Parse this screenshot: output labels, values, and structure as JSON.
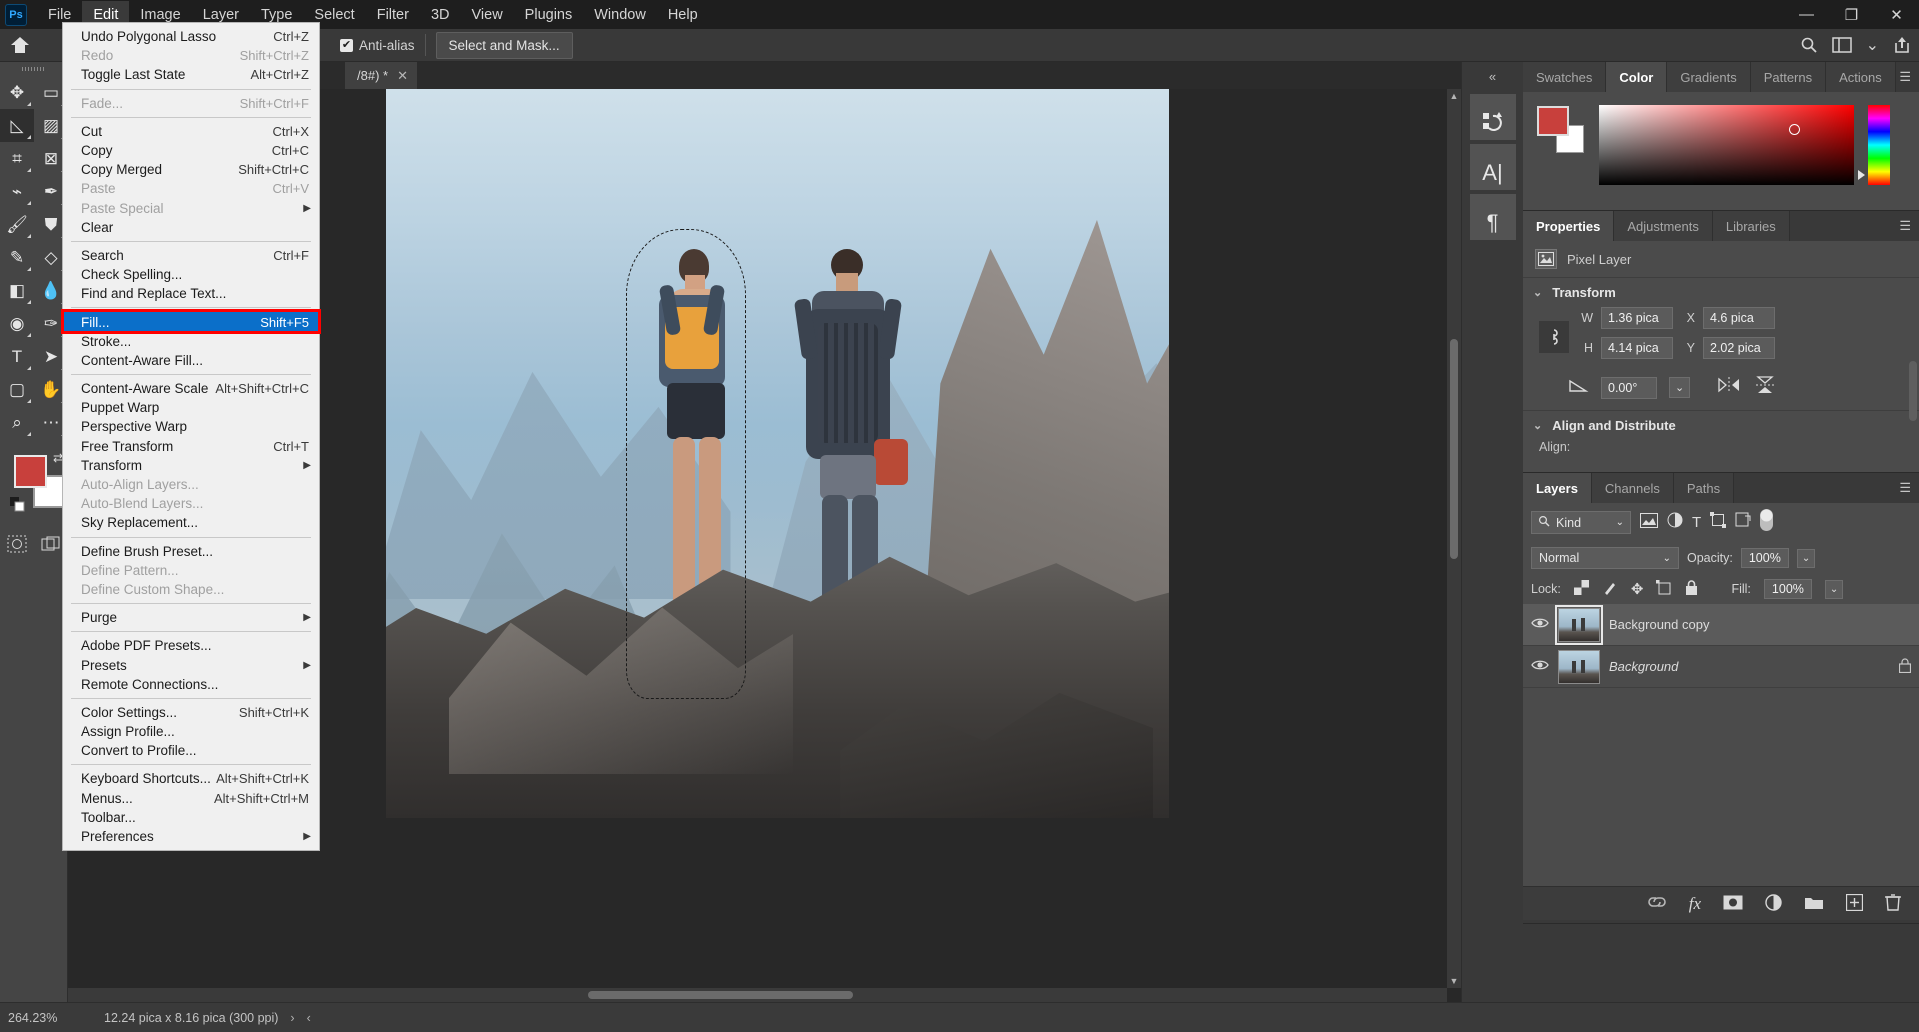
{
  "app": {
    "name": "Adobe Photoshop",
    "logo_text": "Ps"
  },
  "menubar": {
    "items": [
      {
        "label": "File",
        "active": false
      },
      {
        "label": "Edit",
        "active": true
      },
      {
        "label": "Image",
        "active": false
      },
      {
        "label": "Layer",
        "active": false
      },
      {
        "label": "Type",
        "active": false
      },
      {
        "label": "Select",
        "active": false
      },
      {
        "label": "Filter",
        "active": false
      },
      {
        "label": "3D",
        "active": false
      },
      {
        "label": "View",
        "active": false
      },
      {
        "label": "Plugins",
        "active": false
      },
      {
        "label": "Window",
        "active": false
      },
      {
        "label": "Help",
        "active": false
      }
    ]
  },
  "window_controls": {
    "minimize": "minimize-icon",
    "restore": "restore-icon",
    "close": "close-icon"
  },
  "options_bar": {
    "home_icon": "home-icon",
    "anti_alias_label": "Anti-alias",
    "anti_alias_checked": true,
    "select_and_mask_label": "Select and Mask...",
    "search_icon": "search-icon",
    "workspace_icon": "workspace-icon",
    "chevron_icon": "chevron-down-icon",
    "share_icon": "share-icon"
  },
  "document_tab": {
    "title": "/8#) *",
    "close_icon": "close-icon"
  },
  "toolbar": {
    "tools": [
      {
        "name": "move-tool",
        "glyph": "✥",
        "selected": false
      },
      {
        "name": "rectangular-marquee-tool",
        "glyph": "▭",
        "selected": false
      },
      {
        "name": "polygonal-lasso-tool",
        "glyph": "◺",
        "selected": true
      },
      {
        "name": "object-selection-tool",
        "glyph": "▨",
        "selected": false
      },
      {
        "name": "crop-tool",
        "glyph": "⌗",
        "selected": false
      },
      {
        "name": "frame-tool",
        "glyph": "⊠",
        "selected": false
      },
      {
        "name": "eyedropper-tool",
        "glyph": "⌁",
        "selected": false
      },
      {
        "name": "spot-healing-brush-tool",
        "glyph": "✒",
        "selected": false
      },
      {
        "name": "brush-tool",
        "glyph": "🖌",
        "selected": false
      },
      {
        "name": "clone-stamp-tool",
        "glyph": "⛊",
        "selected": false
      },
      {
        "name": "history-brush-tool",
        "glyph": "✎",
        "selected": false
      },
      {
        "name": "eraser-tool",
        "glyph": "◇",
        "selected": false
      },
      {
        "name": "gradient-tool",
        "glyph": "◧",
        "selected": false
      },
      {
        "name": "blur-tool",
        "glyph": "💧",
        "selected": false
      },
      {
        "name": "dodge-tool",
        "glyph": "◉",
        "selected": false
      },
      {
        "name": "pen-tool",
        "glyph": "✑",
        "selected": false
      },
      {
        "name": "horizontal-type-tool",
        "glyph": "T",
        "selected": false
      },
      {
        "name": "path-selection-tool",
        "glyph": "➤",
        "selected": false
      },
      {
        "name": "rectangle-tool",
        "glyph": "▢",
        "selected": false
      },
      {
        "name": "hand-tool",
        "glyph": "✋",
        "selected": false
      },
      {
        "name": "zoom-tool",
        "glyph": "⌕",
        "selected": false
      },
      {
        "name": "edit-toolbar-tool",
        "glyph": "⋯",
        "selected": false
      }
    ],
    "foreground_color": "#c8403c",
    "background_color": "#ffffff",
    "swap_icon": "swap-colors-icon",
    "default_colors_icon": "default-colors-icon",
    "quick_mask_icon": "quick-mask-icon",
    "screen_mode_icon": "screen-mode-icon"
  },
  "dock_rail": {
    "collapse_icon": "collapse-panels-icon",
    "buttons": [
      {
        "name": "history-panel-button",
        "glyph": "↺"
      },
      {
        "name": "character-panel-button",
        "glyph": "A"
      },
      {
        "name": "paragraph-panel-button",
        "glyph": "¶"
      }
    ]
  },
  "color_panel": {
    "tabs": [
      {
        "label": "Swatches",
        "active": false
      },
      {
        "label": "Color",
        "active": true
      },
      {
        "label": "Gradients",
        "active": false
      },
      {
        "label": "Patterns",
        "active": false
      },
      {
        "label": "Actions",
        "active": false
      }
    ],
    "menu_icon": "panel-menu-icon",
    "foreground_color": "#c8403c",
    "background_color": "#ffffff"
  },
  "properties_panel": {
    "tabs": [
      {
        "label": "Properties",
        "active": true
      },
      {
        "label": "Adjustments",
        "active": false
      },
      {
        "label": "Libraries",
        "active": false
      }
    ],
    "menu_icon": "panel-menu-icon",
    "layer_kind": "Pixel Layer",
    "layer_kind_icon": "pixel-layer-icon",
    "transform": {
      "section_title": "Transform",
      "w_label": "W",
      "w_value": "1.36 pica",
      "h_label": "H",
      "h_value": "4.14 pica",
      "x_label": "X",
      "x_value": "4.6 pica",
      "y_label": "Y",
      "y_value": "2.02 pica",
      "angle_label": "angle-icon",
      "angle_value": "0.00°",
      "link_icon": "link-wh-icon",
      "flip_horizontal_icon": "flip-horizontal-icon",
      "flip_vertical_icon": "flip-vertical-icon"
    },
    "align": {
      "section_title": "Align and Distribute",
      "align_label": "Align:"
    }
  },
  "layers_panel": {
    "tabs": [
      {
        "label": "Layers",
        "active": true
      },
      {
        "label": "Channels",
        "active": false
      },
      {
        "label": "Paths",
        "active": false
      }
    ],
    "menu_icon": "panel-menu-icon",
    "filter": {
      "kind_label": "Kind",
      "search_icon": "search-icon",
      "chevron_icon": "chevron-down-icon",
      "filter_icons": [
        "pixel-filter-icon",
        "adjustment-filter-icon",
        "type-filter-icon",
        "shape-filter-icon",
        "smart-object-filter-icon"
      ],
      "toggle_icon": "filter-toggle-icon"
    },
    "blend_mode": "Normal",
    "opacity_label": "Opacity:",
    "opacity_value": "100%",
    "lock_label": "Lock:",
    "lock_icons": [
      "lock-transparent-pixels-icon",
      "lock-image-pixels-icon",
      "lock-position-icon",
      "lock-artboard-nesting-icon",
      "lock-all-icon"
    ],
    "fill_label": "Fill:",
    "fill_value": "100%",
    "layers": [
      {
        "name": "Background copy",
        "visible": true,
        "selected": true,
        "locked": false,
        "italic": false
      },
      {
        "name": "Background",
        "visible": true,
        "selected": false,
        "locked": true,
        "italic": true
      }
    ],
    "footer_icons": [
      "link-layers-icon",
      "layer-style-fx-icon",
      "add-layer-mask-icon",
      "new-fill-adjustment-layer-icon",
      "new-group-icon",
      "new-layer-icon",
      "delete-layer-icon"
    ]
  },
  "edit_menu": {
    "highlight_index": 12,
    "items": [
      {
        "label": "Undo Polygonal Lasso",
        "accel": "Ctrl+Z",
        "disabled": false,
        "submenu": false
      },
      {
        "label": "Redo",
        "accel": "Shift+Ctrl+Z",
        "disabled": true,
        "submenu": false
      },
      {
        "label": "Toggle Last State",
        "accel": "Alt+Ctrl+Z",
        "disabled": false,
        "submenu": false
      },
      {
        "separator": true
      },
      {
        "label": "Fade...",
        "accel": "Shift+Ctrl+F",
        "disabled": true,
        "submenu": false
      },
      {
        "separator": true
      },
      {
        "label": "Cut",
        "accel": "Ctrl+X",
        "disabled": false,
        "submenu": false
      },
      {
        "label": "Copy",
        "accel": "Ctrl+C",
        "disabled": false,
        "submenu": false
      },
      {
        "label": "Copy Merged",
        "accel": "Shift+Ctrl+C",
        "disabled": false,
        "submenu": false
      },
      {
        "label": "Paste",
        "accel": "Ctrl+V",
        "disabled": true,
        "submenu": false
      },
      {
        "label": "Paste Special",
        "accel": "",
        "disabled": true,
        "submenu": true
      },
      {
        "label": "Clear",
        "accel": "",
        "disabled": false,
        "submenu": false
      },
      {
        "separator": true
      },
      {
        "label": "Search",
        "accel": "Ctrl+F",
        "disabled": false,
        "submenu": false
      },
      {
        "label": "Check Spelling...",
        "accel": "",
        "disabled": false,
        "submenu": false
      },
      {
        "label": "Find and Replace Text...",
        "accel": "",
        "disabled": false,
        "submenu": false
      },
      {
        "separator": true
      },
      {
        "label": "Fill...",
        "accel": "Shift+F5",
        "disabled": false,
        "submenu": false,
        "highlighted": true
      },
      {
        "label": "Stroke...",
        "accel": "",
        "disabled": false,
        "submenu": false
      },
      {
        "label": "Content-Aware Fill...",
        "accel": "",
        "disabled": false,
        "submenu": false
      },
      {
        "separator": true
      },
      {
        "label": "Content-Aware Scale",
        "accel": "Alt+Shift+Ctrl+C",
        "disabled": false,
        "submenu": false
      },
      {
        "label": "Puppet Warp",
        "accel": "",
        "disabled": false,
        "submenu": false
      },
      {
        "label": "Perspective Warp",
        "accel": "",
        "disabled": false,
        "submenu": false
      },
      {
        "label": "Free Transform",
        "accel": "Ctrl+T",
        "disabled": false,
        "submenu": false
      },
      {
        "label": "Transform",
        "accel": "",
        "disabled": false,
        "submenu": true
      },
      {
        "label": "Auto-Align Layers...",
        "accel": "",
        "disabled": true,
        "submenu": false
      },
      {
        "label": "Auto-Blend Layers...",
        "accel": "",
        "disabled": true,
        "submenu": false
      },
      {
        "label": "Sky Replacement...",
        "accel": "",
        "disabled": false,
        "submenu": false
      },
      {
        "separator": true
      },
      {
        "label": "Define Brush Preset...",
        "accel": "",
        "disabled": false,
        "submenu": false
      },
      {
        "label": "Define Pattern...",
        "accel": "",
        "disabled": true,
        "submenu": false
      },
      {
        "label": "Define Custom Shape...",
        "accel": "",
        "disabled": true,
        "submenu": false
      },
      {
        "separator": true
      },
      {
        "label": "Purge",
        "accel": "",
        "disabled": false,
        "submenu": true
      },
      {
        "separator": true
      },
      {
        "label": "Adobe PDF Presets...",
        "accel": "",
        "disabled": false,
        "submenu": false
      },
      {
        "label": "Presets",
        "accel": "",
        "disabled": false,
        "submenu": true
      },
      {
        "label": "Remote Connections...",
        "accel": "",
        "disabled": false,
        "submenu": false
      },
      {
        "separator": true
      },
      {
        "label": "Color Settings...",
        "accel": "Shift+Ctrl+K",
        "disabled": false,
        "submenu": false
      },
      {
        "label": "Assign Profile...",
        "accel": "",
        "disabled": false,
        "submenu": false
      },
      {
        "label": "Convert to Profile...",
        "accel": "",
        "disabled": false,
        "submenu": false
      },
      {
        "separator": true
      },
      {
        "label": "Keyboard Shortcuts...",
        "accel": "Alt+Shift+Ctrl+K",
        "disabled": false,
        "submenu": false
      },
      {
        "label": "Menus...",
        "accel": "Alt+Shift+Ctrl+M",
        "disabled": false,
        "submenu": false
      },
      {
        "label": "Toolbar...",
        "accel": "",
        "disabled": false,
        "submenu": false
      },
      {
        "label": "Preferences",
        "accel": "",
        "disabled": false,
        "submenu": true
      }
    ]
  },
  "status_bar": {
    "zoom": "264.23%",
    "dimensions": "12.24 pica x 8.16 pica (300 ppi)",
    "arrow_right": "›",
    "arrow_left": "‹"
  },
  "canvas": {
    "selection_active": true,
    "selection_label": "marching-ants-selection"
  }
}
